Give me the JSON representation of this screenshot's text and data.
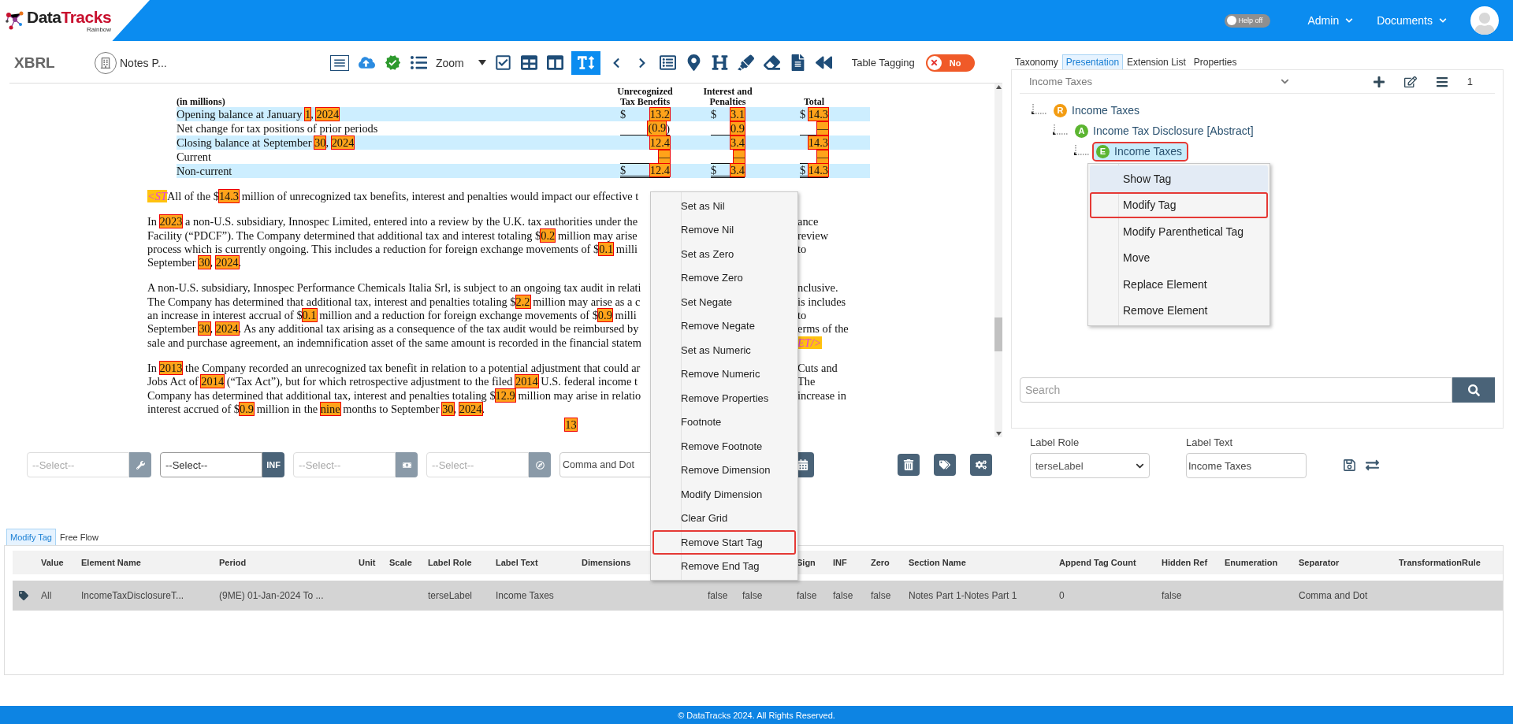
{
  "header": {
    "logo": {
      "part_a": "Data",
      "part_b": "Tracks",
      "tagline": "Rainbow"
    },
    "help": {
      "label": "Help off",
      "on": false
    },
    "nav": [
      "Admin",
      "Documents"
    ]
  },
  "toolbar": {
    "title": "XBRL",
    "document": "Notes P...",
    "tools": [
      {
        "kind": "outline",
        "selected": false
      },
      {
        "kind": "upload",
        "selected": false
      },
      {
        "kind": "verified",
        "selected": false
      },
      {
        "kind": "list",
        "selected": false
      },
      {
        "kind": "zoom",
        "label": "Zoom",
        "selected": false
      },
      {
        "kind": "check",
        "selected": false
      },
      {
        "kind": "table",
        "selected": false
      },
      {
        "kind": "columns",
        "selected": false
      },
      {
        "kind": "text-type",
        "selected": true
      },
      {
        "kind": "prev",
        "selected": false
      },
      {
        "kind": "next",
        "selected": false
      },
      {
        "kind": "card",
        "selected": false
      },
      {
        "kind": "pin",
        "selected": false
      },
      {
        "kind": "heading",
        "selected": false
      },
      {
        "kind": "highlight",
        "selected": false
      },
      {
        "kind": "unhighlight",
        "selected": false
      },
      {
        "kind": "document",
        "selected": false
      },
      {
        "kind": "rewind",
        "selected": false
      }
    ],
    "table_tagging": {
      "label": "Table Tagging",
      "value": "No",
      "on": false
    }
  },
  "document": {
    "table": {
      "caption": "(in millions)",
      "columns": [
        "Unrecognized Tax Benefits",
        "Interest and Penalties",
        "Total"
      ],
      "rows": [
        {
          "shaded": true,
          "label": [
            {
              "text": "Opening balance at January ",
              "kind": "plain"
            },
            {
              "text": "1",
              "kind": "tag"
            },
            {
              "text": ", ",
              "kind": "plain"
            },
            {
              "text": "2024",
              "kind": "tag"
            }
          ],
          "cells": [
            {
              "currency": "$",
              "value": "13.2"
            },
            {
              "currency": "$",
              "value": "3.1"
            },
            {
              "currency": "$",
              "value": "14.3"
            }
          ]
        },
        {
          "shaded": false,
          "label": [
            {
              "text": "Net change for tax positions of prior periods",
              "kind": "plain"
            }
          ],
          "cells": [
            {
              "value": "(0.9",
              "suffix": ")"
            },
            {
              "value": "0.9"
            },
            {
              "value": "—"
            }
          ]
        },
        {
          "shaded": true,
          "label": [
            {
              "text": "Closing balance at September ",
              "kind": "plain"
            },
            {
              "text": "30",
              "kind": "tag"
            },
            {
              "text": ", ",
              "kind": "plain"
            },
            {
              "text": "2024",
              "kind": "tag"
            }
          ],
          "cells": [
            {
              "value": "12.4"
            },
            {
              "value": "3.4"
            },
            {
              "value": "14.3"
            }
          ]
        },
        {
          "shaded": false,
          "label": [
            {
              "text": "Current",
              "kind": "plain"
            }
          ],
          "cells": [
            {
              "value": "—"
            },
            {
              "value": "—"
            },
            {
              "value": "—"
            }
          ]
        },
        {
          "shaded": true,
          "label": [
            {
              "text": "Non-current",
              "kind": "plain"
            }
          ],
          "cells": [
            {
              "currency": "$",
              "value": "12.4"
            },
            {
              "currency": "$",
              "value": "3.4"
            },
            {
              "currency": "$",
              "value": "14.3"
            }
          ]
        }
      ]
    },
    "paragraphs": [
      [
        {
          "left": [
            {
              "text": "<ST",
              "kind": "marker"
            },
            {
              "text": "All of the $",
              "kind": "plain"
            },
            {
              "text": "14.3",
              "kind": "tag"
            },
            {
              "text": " million of unrecognized tax benefits, interest and penalties would impact our effective t",
              "kind": "plain"
            }
          ]
        }
      ],
      [
        {
          "left": [
            {
              "text": "In ",
              "kind": "plain"
            },
            {
              "text": "2023",
              "kind": "tag"
            },
            {
              "text": " a non-U.S. subsidiary, Innospec Limited, entered into a review by the U.K. tax authorities under the",
              "kind": "plain"
            }
          ],
          "right": [
            {
              "text": "ance",
              "kind": "plain"
            }
          ]
        },
        {
          "left": [
            {
              "text": "Facility (“PDCF”). The Company determined that additional tax and interest totaling $",
              "kind": "plain"
            },
            {
              "text": "0.2",
              "kind": "tag"
            },
            {
              "text": " million may arise",
              "kind": "plain"
            }
          ],
          "right": [
            {
              "text": "review",
              "kind": "plain"
            }
          ]
        },
        {
          "left": [
            {
              "text": "process which is currently ongoing. This includes a reduction for foreign exchange movements of $",
              "kind": "plain"
            },
            {
              "text": "0.1",
              "kind": "tag"
            },
            {
              "text": " milli",
              "kind": "plain"
            }
          ],
          "right": [
            {
              "text": "to",
              "kind": "plain"
            }
          ]
        },
        {
          "left": [
            {
              "text": "September ",
              "kind": "plain"
            },
            {
              "text": "30",
              "kind": "tag"
            },
            {
              "text": ", ",
              "kind": "plain"
            },
            {
              "text": "2024",
              "kind": "tag"
            },
            {
              "text": ".",
              "kind": "plain"
            }
          ]
        }
      ],
      [
        {
          "left": [
            {
              "text": "A non-U.S. subsidiary, Innospec Performance Chemicals Italia Srl, is subject to an ongoing tax audit in relati",
              "kind": "plain"
            }
          ],
          "right": [
            {
              "text": "nclusive.",
              "kind": "plain"
            }
          ]
        },
        {
          "left": [
            {
              "text": "The Company has determined that additional tax, interest and penalties totaling $",
              "kind": "plain"
            },
            {
              "text": "2.2",
              "kind": "tag"
            },
            {
              "text": " million may arise as a c",
              "kind": "plain"
            }
          ],
          "right": [
            {
              "text": "is includes",
              "kind": "plain"
            }
          ]
        },
        {
          "left": [
            {
              "text": "an increase in interest accrual of $",
              "kind": "plain"
            },
            {
              "text": "0.1",
              "kind": "tag"
            },
            {
              "text": " million and a reduction for foreign exchange movements of $",
              "kind": "plain"
            },
            {
              "text": "0.9",
              "kind": "tag"
            },
            {
              "text": " milli",
              "kind": "plain"
            }
          ],
          "right": [
            {
              "text": "to",
              "kind": "plain"
            }
          ]
        },
        {
          "left": [
            {
              "text": "September ",
              "kind": "plain"
            },
            {
              "text": "30",
              "kind": "tag"
            },
            {
              "text": ", ",
              "kind": "plain"
            },
            {
              "text": "2024",
              "kind": "tag"
            },
            {
              "text": ". As any additional tax arising as a consequence of the tax audit would be reimbursed by",
              "kind": "plain"
            }
          ],
          "right": [
            {
              "text": "erms of the",
              "kind": "plain"
            }
          ]
        },
        {
          "left": [
            {
              "text": "sale and purchase agreement, an indemnification asset of the same amount is recorded in the financial statem",
              "kind": "plain"
            }
          ],
          "right": [
            {
              "text": "ET/>",
              "kind": "marker"
            }
          ]
        }
      ],
      [
        {
          "left": [
            {
              "text": "In ",
              "kind": "plain"
            },
            {
              "text": "2013",
              "kind": "tag"
            },
            {
              "text": " the Company recorded an unrecognized tax benefit in relation to a potential adjustment that could ar",
              "kind": "plain"
            }
          ],
          "right": [
            {
              "text": "Cuts and",
              "kind": "plain"
            }
          ]
        },
        {
          "left": [
            {
              "text": "Jobs Act of ",
              "kind": "plain"
            },
            {
              "text": "2014",
              "kind": "tag"
            },
            {
              "text": " (“Tax Act”), but for which retrospective adjustment to the filed ",
              "kind": "plain"
            },
            {
              "text": "2014",
              "kind": "tag"
            },
            {
              "text": " U.S. federal income t",
              "kind": "plain"
            }
          ],
          "right": [
            {
              "text": "The",
              "kind": "plain"
            }
          ]
        },
        {
          "left": [
            {
              "text": "Company has determined that additional tax, interest and penalties totaling $",
              "kind": "plain"
            },
            {
              "text": "12.9",
              "kind": "tag"
            },
            {
              "text": " million may arise in relatio",
              "kind": "plain"
            }
          ],
          "right": [
            {
              "text": "increase in",
              "kind": "plain"
            }
          ]
        },
        {
          "left": [
            {
              "text": "interest accrued of $",
              "kind": "plain"
            },
            {
              "text": "0.9",
              "kind": "tag"
            },
            {
              "text": " million in the ",
              "kind": "plain"
            },
            {
              "text": "nine",
              "kind": "tag"
            },
            {
              "text": " months to September ",
              "kind": "plain"
            },
            {
              "text": "30",
              "kind": "tag"
            },
            {
              "text": ", ",
              "kind": "plain"
            },
            {
              "text": "2024",
              "kind": "tag"
            },
            {
              "text": ".",
              "kind": "plain"
            }
          ]
        }
      ]
    ],
    "page_number": "13"
  },
  "filters": {
    "selects": [
      {
        "placeholder": "--Select--",
        "kind": "wrench"
      },
      {
        "value": "--Select--",
        "kind": "text",
        "button_text": "INF"
      },
      {
        "placeholder": "--Select--",
        "kind": "money"
      },
      {
        "placeholder": "--Select--",
        "kind": "compass"
      }
    ],
    "separator": "Comma and Dot",
    "actions": [
      {
        "kind": "trash"
      },
      {
        "kind": "tags"
      },
      {
        "kind": "gear"
      }
    ]
  },
  "context_menu": [
    {
      "label": "Set as Nil",
      "outlined": false
    },
    {
      "label": "Remove Nil",
      "outlined": false
    },
    {
      "label": "Set as Zero",
      "outlined": false
    },
    {
      "label": "Remove Zero",
      "outlined": false
    },
    {
      "label": "Set Negate",
      "outlined": false
    },
    {
      "label": "Remove Negate",
      "outlined": false
    },
    {
      "label": "Set as Numeric",
      "outlined": false
    },
    {
      "label": "Remove Numeric",
      "outlined": false
    },
    {
      "label": "Remove Properties",
      "outlined": false
    },
    {
      "label": "Footnote",
      "outlined": false
    },
    {
      "label": "Remove Footnote",
      "outlined": false
    },
    {
      "label": "Remove Dimension",
      "outlined": false
    },
    {
      "label": "Modify Dimension",
      "outlined": false
    },
    {
      "label": "Clear Grid",
      "outlined": false
    },
    {
      "label": "Remove Start Tag",
      "outlined": true
    },
    {
      "label": "Remove End Tag",
      "outlined": false
    }
  ],
  "side_panel": {
    "tabs": [
      {
        "label": "Taxonomy",
        "selected": false
      },
      {
        "label": "Presentation",
        "selected": true
      },
      {
        "label": "Extension List",
        "selected": false
      },
      {
        "label": "Properties",
        "selected": false
      }
    ],
    "role_select": "Income Taxes",
    "count": "1",
    "tree": [
      {
        "badge": "R",
        "color": "#f39c12",
        "label": "Income Taxes",
        "selected": false,
        "outlined": false,
        "children": [
          {
            "badge": "A",
            "color": "#5cb531",
            "label": "Income Tax Disclosure [Abstract]",
            "selected": false,
            "outlined": false,
            "children": [
              {
                "badge": "E",
                "color": "#5cb531",
                "label": "Income Taxes",
                "selected": true,
                "outlined": true
              }
            ]
          }
        ]
      }
    ],
    "menu": [
      {
        "label": "Show Tag",
        "hovered": true,
        "outlined": false
      },
      {
        "label": "Modify Tag",
        "hovered": false,
        "outlined": true
      },
      {
        "label": "Modify Parenthetical Tag",
        "hovered": false,
        "outlined": false
      },
      {
        "label": "Move",
        "hovered": false,
        "outlined": false
      },
      {
        "label": "Replace Element",
        "hovered": false,
        "outlined": false
      },
      {
        "label": "Remove Element",
        "hovered": false,
        "outlined": false
      }
    ],
    "search_placeholder": "Search",
    "label_role": {
      "label": "Label Role",
      "value": "terseLabel"
    },
    "label_text": {
      "label": "Label Text",
      "value": "Income Taxes"
    }
  },
  "grid": {
    "tabs": [
      {
        "label": "Modify Tag",
        "selected": true
      },
      {
        "label": "Free Flow",
        "selected": false
      }
    ],
    "columns": [
      "",
      "Value",
      "Element Name",
      "Period",
      "Unit",
      "Scale",
      "Label Role",
      "Label Text",
      "Dimensions",
      "",
      "",
      "",
      "Sign",
      "INF",
      "Zero",
      "Section Name",
      "Append Tag Count",
      "Hidden Ref",
      "Enumeration",
      "Separator",
      "TransformationRule"
    ],
    "rows": [
      {
        "cells": [
          "",
          "All",
          "IncomeTaxDisclosureT...",
          "(9ME) 01-Jan-2024 To ...",
          "",
          "",
          "terseLabel",
          "Income Taxes",
          "",
          "",
          "false",
          "false",
          "false",
          "false",
          "false",
          "Notes Part 1-Notes Part 1",
          "0",
          "false",
          "",
          "Comma and Dot",
          ""
        ]
      }
    ]
  },
  "footer": "© DataTracks 2024. All Rights Reserved."
}
